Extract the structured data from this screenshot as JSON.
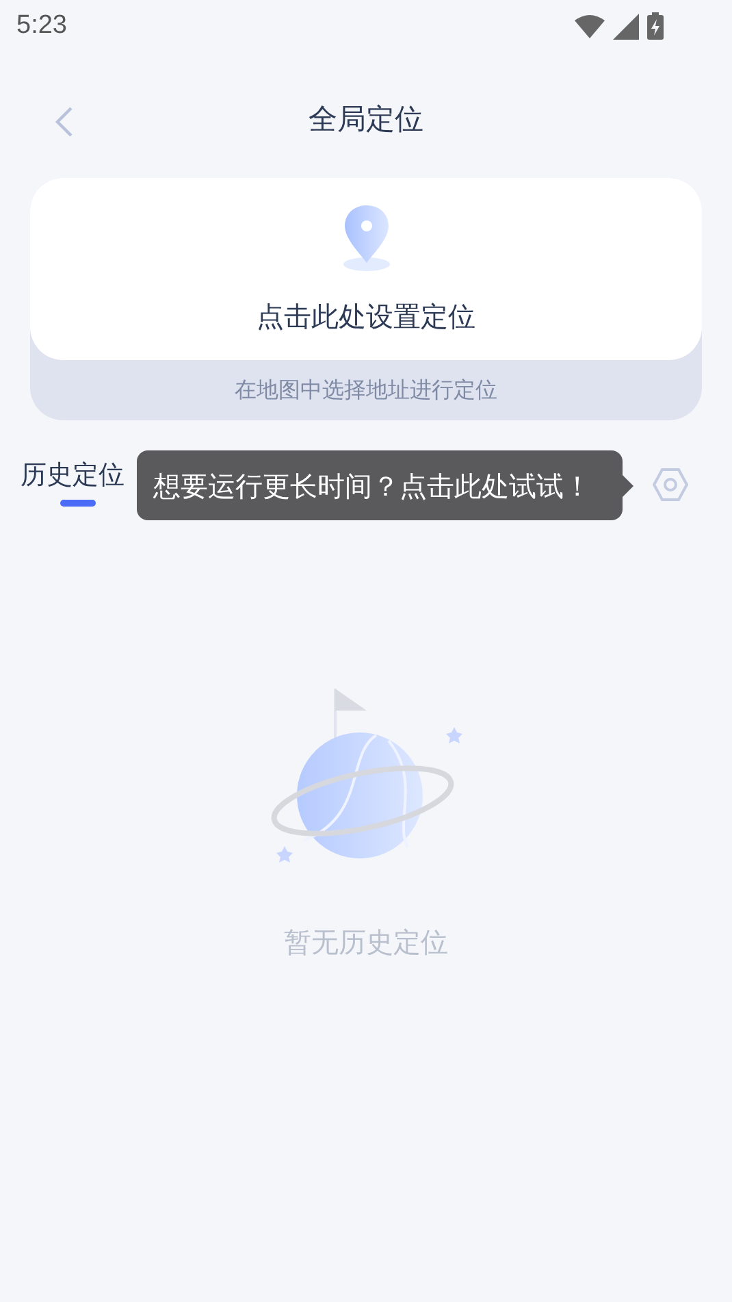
{
  "status_bar": {
    "time": "5:23"
  },
  "header": {
    "title": "全局定位"
  },
  "location_card": {
    "action": "点击此处设置定位",
    "hint": "在地图中选择地址进行定位"
  },
  "tabs": [
    {
      "label": "历史定位",
      "selected": true
    }
  ],
  "tooltip": {
    "text": "想要运行更长时间？点击此处试试！"
  },
  "empty_state": {
    "text": "暂无历史定位"
  }
}
